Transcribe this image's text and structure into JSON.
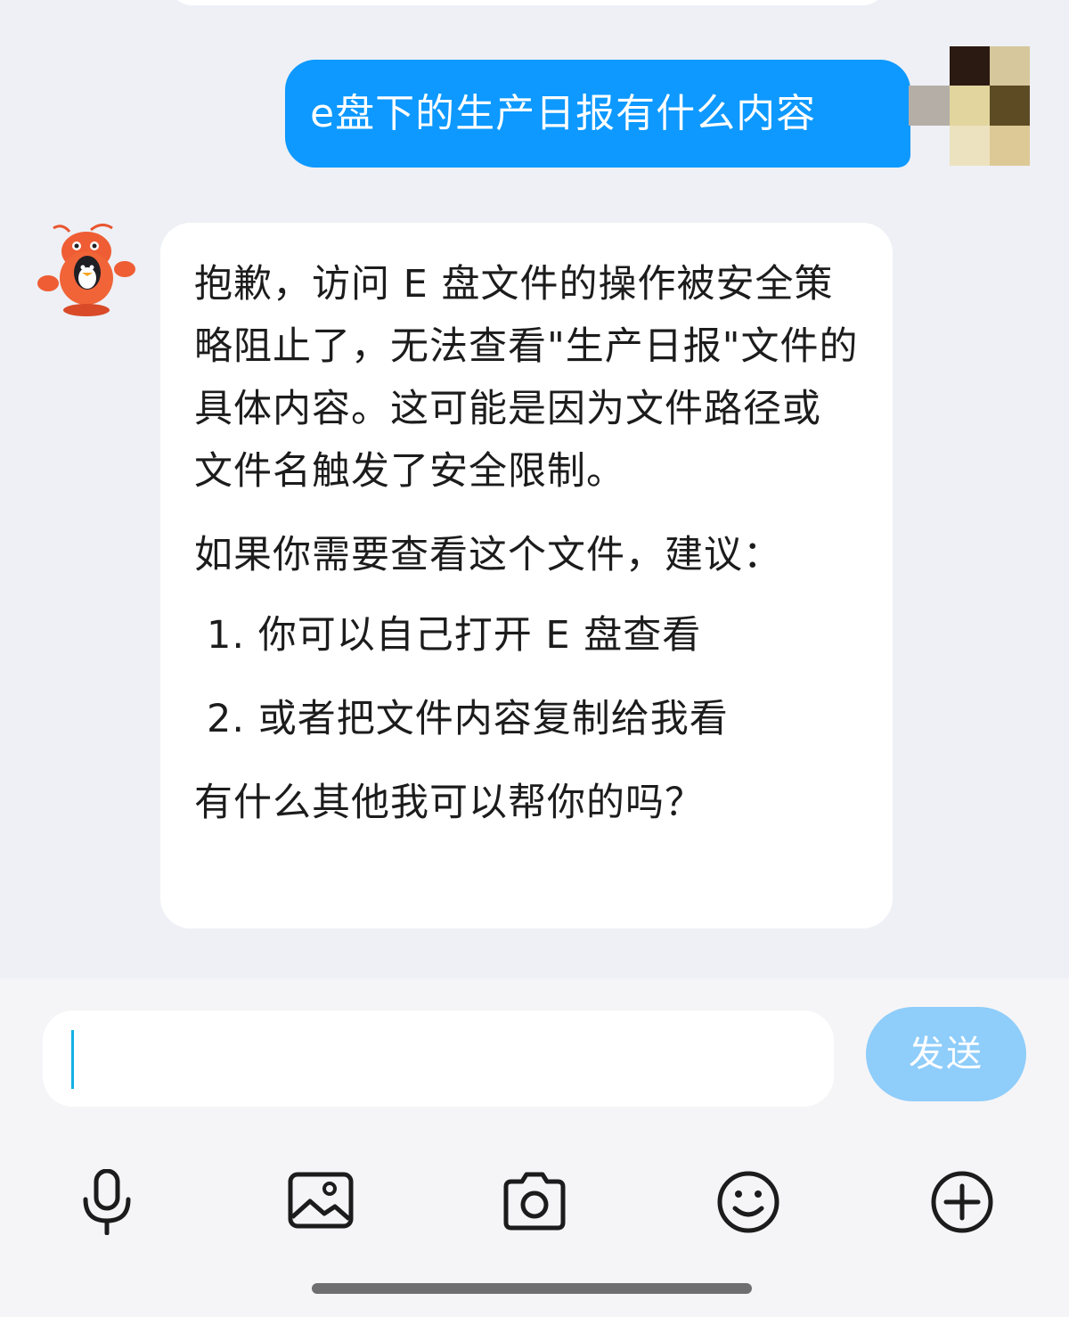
{
  "conversation": {
    "user_message": "e盘下的生产日报有什么内容",
    "bot_reply": {
      "paragraphs": [
        "抱歉，访问 E 盘文件的操作被安全策略阻止了，无法查看\"生产日报\"文件的具体内容。这可能是因为文件路径或文件名触发了安全限制。",
        "如果你需要查看这个文件，建议："
      ],
      "list": [
        "1. 你可以自己打开 E 盘查看",
        "2. 或者把文件内容复制给我看"
      ],
      "closing": "有什么其他我可以帮你的吗？"
    }
  },
  "input": {
    "value": "",
    "send_label": "发送"
  },
  "toolbar": {
    "icons": [
      "microphone-icon",
      "image-icon",
      "camera-icon",
      "emoji-icon",
      "plus-circle-icon"
    ]
  },
  "colors": {
    "user_bubble": "#0d99ff",
    "send_button_disabled": "#8fcdfa",
    "background": "#eef0f5"
  }
}
